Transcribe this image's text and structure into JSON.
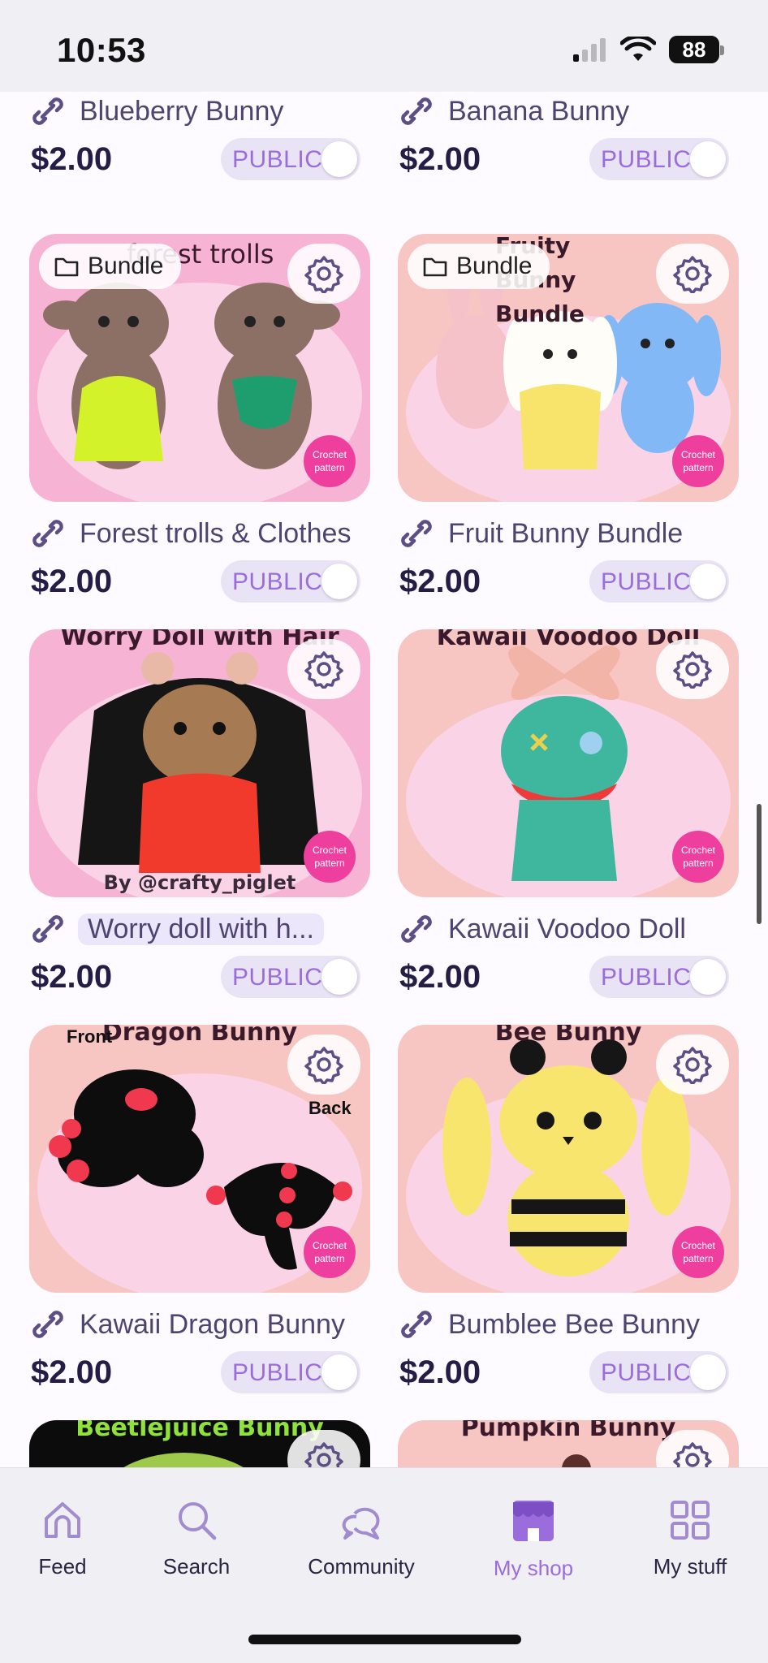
{
  "status": {
    "time": "10:53",
    "battery": "88"
  },
  "products": [
    {
      "name": "Blueberry Bunny",
      "price": "$2.00",
      "visibility": "PUBLIC"
    },
    {
      "name": "Banana Bunny",
      "price": "$2.00",
      "visibility": "PUBLIC"
    },
    {
      "name": "Forest trolls & Clothes",
      "price": "$2.00",
      "visibility": "PUBLIC",
      "tag": "Bundle",
      "art_title": "forest trolls"
    },
    {
      "name": "Fruit Bunny Bundle",
      "price": "$2.00",
      "visibility": "PUBLIC",
      "tag": "Bundle",
      "art_title": "Fruity Bunny Bundle"
    },
    {
      "name": "Worry doll with h...",
      "price": "$2.00",
      "visibility": "PUBLIC",
      "art_title": "Worry Doll with Hair",
      "credit": "By @crafty_piglet"
    },
    {
      "name": "Kawaii Voodoo Doll",
      "price": "$2.00",
      "visibility": "PUBLIC",
      "art_title": "Kawaii Voodoo Doll"
    },
    {
      "name": "Kawaii Dragon Bunny",
      "price": "$2.00",
      "visibility": "PUBLIC",
      "art_title": "Dragon Bunny",
      "note_front": "Front",
      "note_back": "Back"
    },
    {
      "name": "Bumblee Bee Bunny",
      "price": "$2.00",
      "visibility": "PUBLIC",
      "art_title": "Bee Bunny"
    },
    {
      "art_title": "Beetlejuice Bunny"
    },
    {
      "art_title": "Pumpkin Bunny"
    }
  ],
  "badge_text": "Crochet pattern",
  "tabs": [
    {
      "label": "Feed",
      "icon": "home-icon"
    },
    {
      "label": "Search",
      "icon": "search-icon"
    },
    {
      "label": "Community",
      "icon": "chat-bubbles-icon"
    },
    {
      "label": "My shop",
      "icon": "storefront-icon",
      "active": true
    },
    {
      "label": "My stuff",
      "icon": "grid-icon"
    }
  ],
  "colors": {
    "accent": "#9b6ddc",
    "price": "#241d45",
    "name": "#4e4470",
    "toggle_bg": "#e9e3f6",
    "thumb_pink": "#f6b3d4",
    "thumb_peach": "#f7c6c2"
  }
}
